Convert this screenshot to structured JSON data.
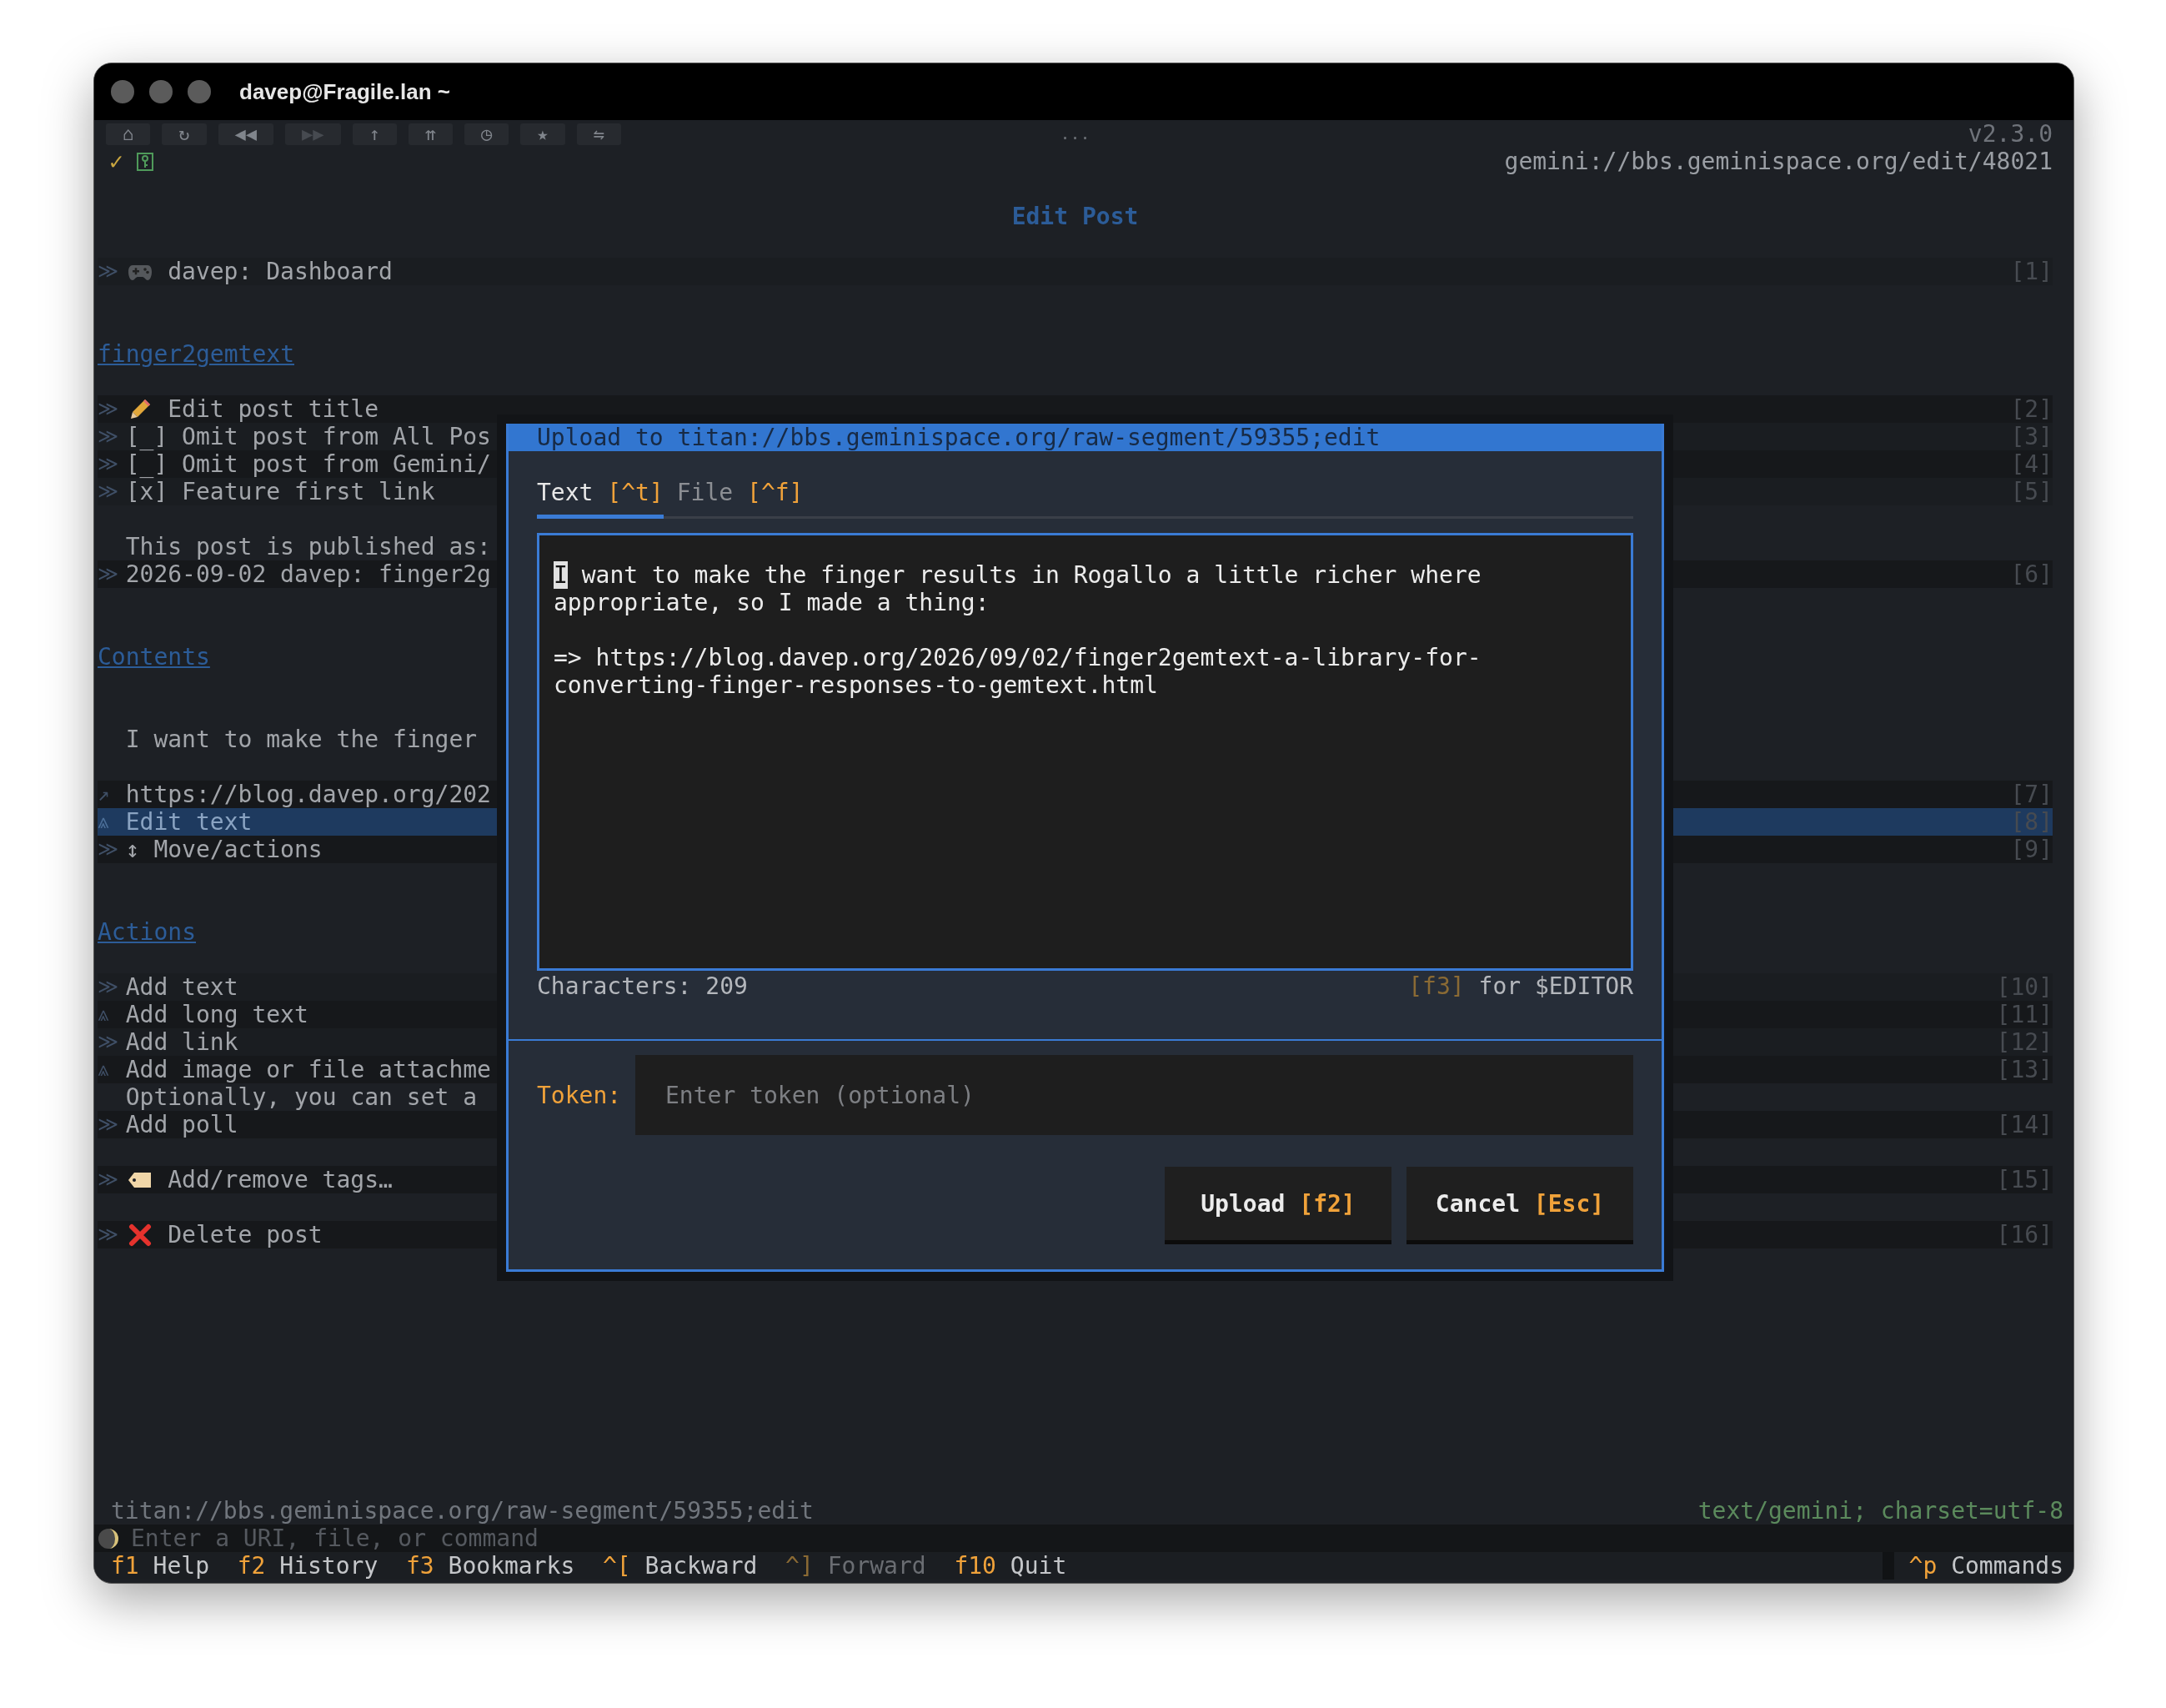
{
  "window": {
    "title": "davep@Fragile.lan ~"
  },
  "toolbar": {
    "buttons": [
      {
        "label": "⌂",
        "disabled": false
      },
      {
        "label": "↻",
        "disabled": false
      },
      {
        "label": "◀◀",
        "disabled": false
      },
      {
        "label": "▶▶",
        "disabled": true
      },
      {
        "label": "↑",
        "disabled": false
      },
      {
        "label": "⇈",
        "disabled": false
      },
      {
        "label": "◷",
        "disabled": false
      },
      {
        "label": "★",
        "disabled": false
      },
      {
        "label": "⇋",
        "disabled": false
      }
    ],
    "handle": "...",
    "version": "v2.3.0"
  },
  "indicators": {
    "check": "✓"
  },
  "address": "gemini://bbs.geminispace.org/edit/48021",
  "page": {
    "title": "Edit Post",
    "lines": [
      {
        "kind": "dashboard",
        "marker": "≫",
        "label": "davep: Dashboard",
        "number": "[1]",
        "selected": false
      },
      {
        "kind": "blank"
      },
      {
        "kind": "blank"
      },
      {
        "kind": "heading",
        "text": "finger2gemtext"
      },
      {
        "kind": "blank"
      },
      {
        "kind": "rename",
        "marker": "≫",
        "label": "Edit post title",
        "number": "[2]",
        "selected": false
      },
      {
        "kind": "item",
        "marker": "≫",
        "label": "[_] Omit post from All Pos",
        "number": "[3]",
        "selected": false
      },
      {
        "kind": "item",
        "marker": "≫",
        "label": "[_] Omit post from Gemini/",
        "number": "[4]",
        "selected": false
      },
      {
        "kind": "item",
        "marker": "≫",
        "label": "[x] Feature first link",
        "number": "[5]",
        "selected": false
      },
      {
        "kind": "blank"
      },
      {
        "kind": "text",
        "text": "This post is published as:"
      },
      {
        "kind": "item",
        "marker": "≫",
        "label": "2026-09-02 davep: finger2g",
        "number": "[6]",
        "selected": false
      },
      {
        "kind": "blank"
      },
      {
        "kind": "blank"
      },
      {
        "kind": "heading",
        "text": "Contents"
      },
      {
        "kind": "blank"
      },
      {
        "kind": "blank"
      },
      {
        "kind": "text",
        "text": "I want to make the finger"
      },
      {
        "kind": "blank"
      },
      {
        "kind": "item",
        "marker": "↗",
        "label": "https://blog.davep.org/202",
        "number": "[7]",
        "selected": false
      },
      {
        "kind": "item",
        "marker": "⩓",
        "label": "Edit text",
        "number": "[8]",
        "selected": true
      },
      {
        "kind": "item",
        "marker": "≫",
        "label": "↕ Move/actions",
        "number": "[9]",
        "selected": false
      },
      {
        "kind": "blank"
      },
      {
        "kind": "blank"
      },
      {
        "kind": "heading",
        "text": "Actions"
      },
      {
        "kind": "blank"
      },
      {
        "kind": "item",
        "marker": "≫",
        "label": "Add text",
        "number": "[10]",
        "selected": false
      },
      {
        "kind": "item",
        "marker": "⩓",
        "label": "Add long text",
        "number": "[11]",
        "selected": false
      },
      {
        "kind": "item",
        "marker": "≫",
        "label": "Add link",
        "number": "[12]",
        "selected": false
      },
      {
        "kind": "item",
        "marker": "⩓",
        "label": "Add image or file attachme",
        "number": "[13]",
        "selected": false
      },
      {
        "kind": "text",
        "text": "Optionally, you can set a"
      },
      {
        "kind": "item",
        "marker": "≫",
        "label": "Add poll",
        "number": "[14]",
        "selected": false
      },
      {
        "kind": "blank"
      },
      {
        "kind": "tags",
        "marker": "≫",
        "label": "Add/remove tags…",
        "number": "[15]",
        "selected": false
      },
      {
        "kind": "blank"
      },
      {
        "kind": "delete",
        "marker": "≫",
        "label": "Delete post",
        "number": "[16]",
        "selected": false
      }
    ]
  },
  "dialog": {
    "title": "Upload to titan://bbs.geminispace.org/raw-segment/59355;edit",
    "tabs": [
      {
        "label": "Text",
        "key": "[^t]",
        "selected": true
      },
      {
        "label": "File",
        "key": "[^f]",
        "selected": false
      }
    ],
    "text": "I want to make the finger results in Rogallo a little richer where appropriate, so I made a thing:\n\n=> https://blog.davep.org/2026/09/02/finger2gemtext-a-library-for-converting-finger-responses-to-gemtext.html",
    "character_count": "Characters: 209",
    "editor_hint": {
      "key": "[f3]",
      "label": "for $EDITOR"
    },
    "token": {
      "label": "Token:",
      "placeholder": "Enter token (optional)"
    },
    "buttons": [
      {
        "label": "Upload",
        "key": "[f2]"
      },
      {
        "label": "Cancel",
        "key": "[Esc]"
      }
    ]
  },
  "status": {
    "uri": "titan://bbs.geminispace.org/raw-segment/59355;edit",
    "mime": "text/gemini; charset=utf-8"
  },
  "command_input": {
    "placeholder": "Enter a URI, file, or command"
  },
  "key_bindings": [
    {
      "key": "f1",
      "label": "Help",
      "disabled": false
    },
    {
      "key": "f2",
      "label": "History",
      "disabled": false
    },
    {
      "key": "f3",
      "label": "Bookmarks",
      "disabled": false
    },
    {
      "key": "^[",
      "label": "Backward",
      "disabled": false
    },
    {
      "key": "^]",
      "label": "Forward",
      "disabled": true
    },
    {
      "key": "f10",
      "label": "Quit",
      "disabled": false
    }
  ],
  "commands_binding": {
    "key": "^p",
    "label": "Commands"
  }
}
